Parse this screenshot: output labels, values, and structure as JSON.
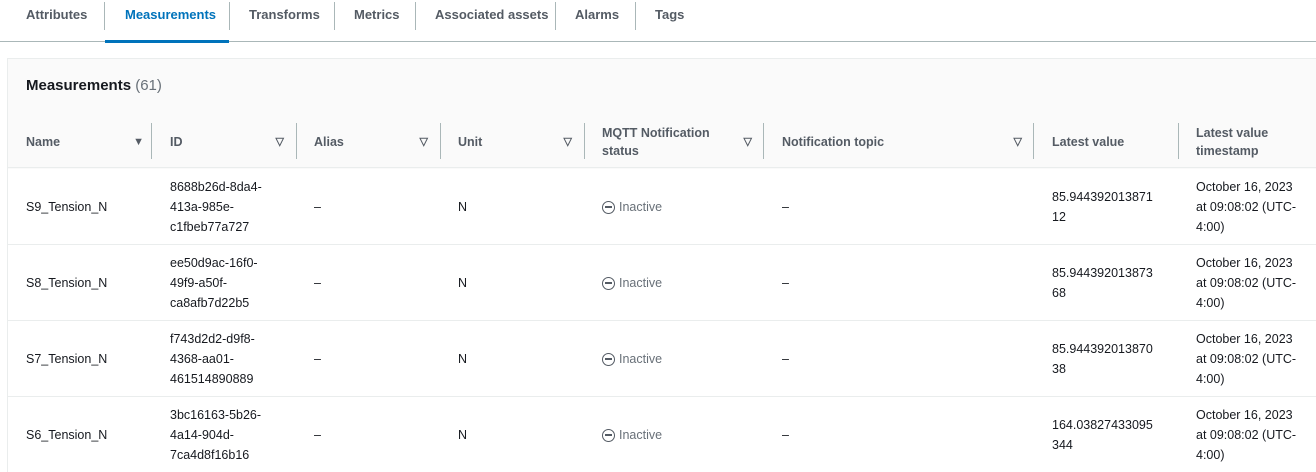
{
  "tabs": [
    {
      "label": "Attributes"
    },
    {
      "label": "Measurements"
    },
    {
      "label": "Transforms"
    },
    {
      "label": "Metrics"
    },
    {
      "label": "Associated assets"
    },
    {
      "label": "Alarms"
    },
    {
      "label": "Tags"
    }
  ],
  "active_tab": "Measurements",
  "panel": {
    "title": "Measurements",
    "count": "(61)"
  },
  "columns": {
    "name": "Name",
    "id": "ID",
    "alias": "Alias",
    "unit": "Unit",
    "mqtt_line1": "MQTT Notification",
    "mqtt_line2": "status",
    "topic": "Notification topic",
    "latest_value": "Latest value",
    "timestamp_line1": "Latest value",
    "timestamp_line2": "timestamp"
  },
  "icons": {
    "sort_active": "caret-down-filled-icon",
    "sort": "caret-down-outline-icon",
    "status": "inactive-status-icon"
  },
  "rows": [
    {
      "name": "S9_Tension_N",
      "id_lines": [
        "8688b26d-8da4-",
        "413a-985e-",
        "c1fbeb77a727"
      ],
      "alias": "–",
      "unit": "N",
      "status": "Inactive",
      "topic": "–",
      "value_lines": [
        "85.944392013871",
        "12"
      ],
      "ts_lines": [
        "October 16, 2023",
        "at 09:08:02 (UTC-",
        "4:00)"
      ]
    },
    {
      "name": "S8_Tension_N",
      "id_lines": [
        "ee50d9ac-16f0-",
        "49f9-a50f-",
        "ca8afb7d22b5"
      ],
      "alias": "–",
      "unit": "N",
      "status": "Inactive",
      "topic": "–",
      "value_lines": [
        "85.944392013873",
        "68"
      ],
      "ts_lines": [
        "October 16, 2023",
        "at 09:08:02 (UTC-",
        "4:00)"
      ]
    },
    {
      "name": "S7_Tension_N",
      "id_lines": [
        "f743d2d2-d9f8-",
        "4368-aa01-",
        "461514890889"
      ],
      "alias": "–",
      "unit": "N",
      "status": "Inactive",
      "topic": "–",
      "value_lines": [
        "85.944392013870",
        "38"
      ],
      "ts_lines": [
        "October 16, 2023",
        "at 09:08:02 (UTC-",
        "4:00)"
      ]
    },
    {
      "name": "S6_Tension_N",
      "id_lines": [
        "3bc16163-5b26-",
        "4a14-904d-",
        "7ca4d8f16b16"
      ],
      "alias": "–",
      "unit": "N",
      "status": "Inactive",
      "topic": "–",
      "value_lines": [
        "164.03827433095",
        "344"
      ],
      "ts_lines": [
        "October 16, 2023",
        "at 09:08:02 (UTC-",
        "4:00)"
      ]
    }
  ]
}
